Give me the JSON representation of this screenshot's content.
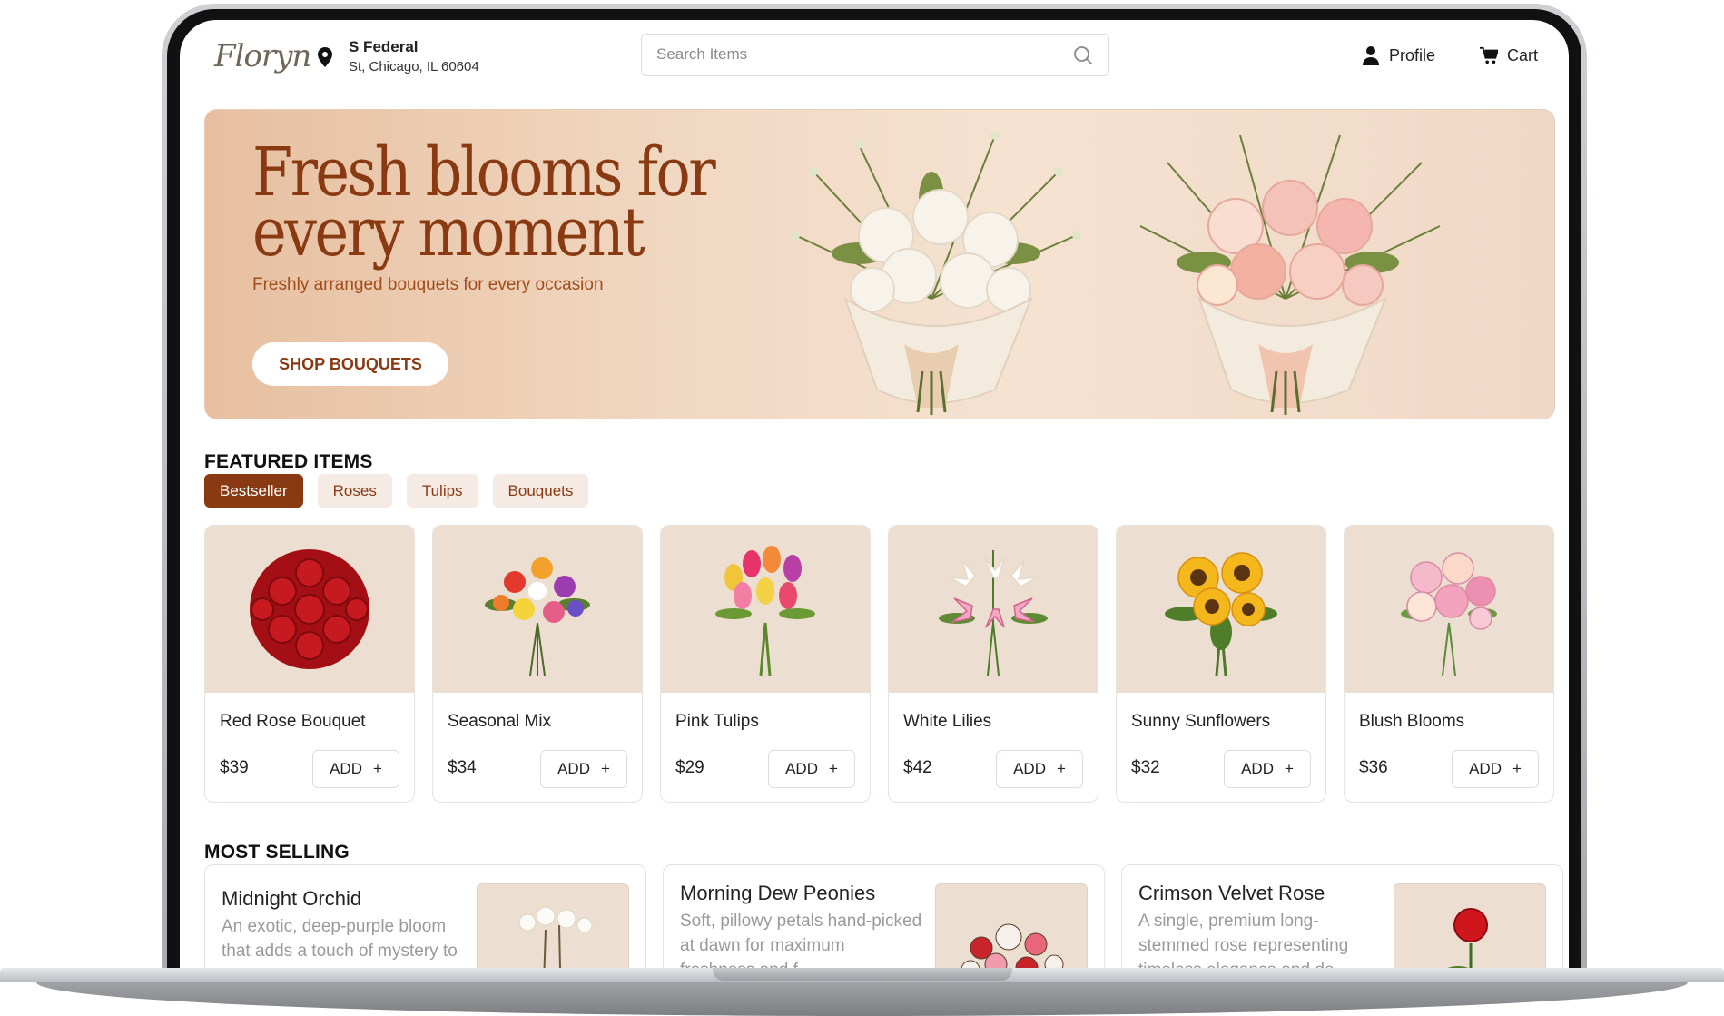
{
  "header": {
    "logo_text": "Floryn",
    "location_line1": "S Federal",
    "location_line2": "St, Chicago, IL 60604",
    "search_placeholder": "Search Items",
    "profile_label": "Profile",
    "cart_label": "Cart"
  },
  "hero": {
    "title_line1": "Fresh blooms for",
    "title_line2": "every moment",
    "subtitle": "Freshly arranged bouquets for every occasion",
    "cta_label": "SHOP BOUQUETS"
  },
  "featured": {
    "title": "FEATURED ITEMS",
    "chips": [
      "Bestseller",
      "Roses",
      "Tulips",
      "Bouquets"
    ],
    "active_chip": "Bestseller",
    "add_label": "ADD",
    "add_icon": "+",
    "items": [
      {
        "name": "Red Rose Bouquet",
        "price": "$39"
      },
      {
        "name": "Seasonal Mix",
        "price": "$34"
      },
      {
        "name": "Pink Tulips",
        "price": "$29"
      },
      {
        "name": "White Lilies",
        "price": "$42"
      },
      {
        "name": "Sunny Sunflowers",
        "price": "$32"
      },
      {
        "name": "Blush Blooms",
        "price": "$36"
      }
    ]
  },
  "most_selling": {
    "title": "MOST SELLING",
    "items": [
      {
        "name": "Midnight Orchid",
        "description": "An exotic, deep-purple bloom that adds a touch of mystery to any room."
      },
      {
        "name": "Morning Dew Peonies",
        "description": "Soft, pillowy petals hand-picked at dawn for maximum freshness and f"
      },
      {
        "name": "Crimson Velvet Rose",
        "description": "A single, premium long-stemmed rose representing timeless elegance and de"
      }
    ]
  },
  "colors": {
    "brand": "#8a3a12",
    "chip_bg": "#f6ebe4",
    "card_image_bg": "#ecdfd2"
  }
}
